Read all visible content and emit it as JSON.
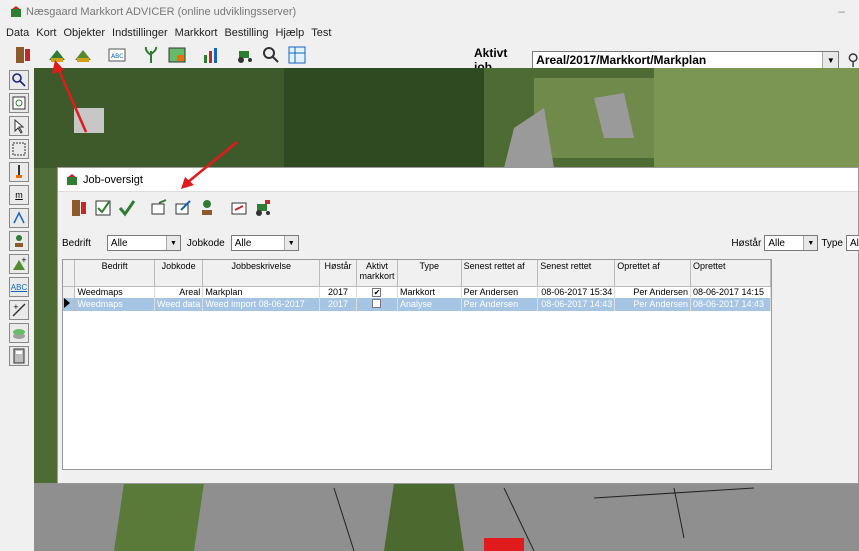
{
  "window": {
    "title": "Næsgaard Markkort ADVICER (online udviklingsserver)",
    "minimize": "–"
  },
  "menu": [
    "Data",
    "Kort",
    "Objekter",
    "Indstillinger",
    "Markkort",
    "Bestilling",
    "Hjælp",
    "Test"
  ],
  "job": {
    "label": "Aktivt job",
    "value": "Areal/2017/Markkort/Markplan"
  },
  "left_toolbar": {
    "abc": "ABC",
    "m_tool": "m"
  },
  "dialog": {
    "title": "Job-oversigt",
    "filters": {
      "bedrift_label": "Bedrift",
      "bedrift_value": "Alle",
      "jobkode_label": "Jobkode",
      "jobkode_value": "Alle",
      "hostar_label": "Høstår",
      "hostar_value": "Alle",
      "type_label": "Type",
      "type_value": "Alle"
    },
    "columns": [
      "Bedrift",
      "Jobkode",
      "Jobbeskrivelse",
      "Høstår",
      "Aktivt markkort",
      "Type",
      "Senest rettet af",
      "Senest rettet",
      "Oprettet af",
      "Oprettet"
    ],
    "rows": [
      {
        "bedrift": "Weedmaps",
        "jobkode": "Areal",
        "beskrivelse": "Markplan",
        "hostar": "2017",
        "aktivt": "✔",
        "type": "Markkort",
        "rettet_af": "Per Andersen",
        "rettet": "08-06-2017 15:34",
        "oprettet_af": "Per Andersen",
        "oprettet": "08-06-2017 14:15"
      },
      {
        "bedrift": "Weedmaps",
        "jobkode": "Weed data",
        "beskrivelse": "Weed import 08-06-2017",
        "hostar": "2017",
        "aktivt": "",
        "type": "Analyse",
        "rettet_af": "Per Andersen",
        "rettet": "08-06-2017 14:43",
        "oprettet_af": "Per Andersen",
        "oprettet": "08-06-2017 14:43"
      }
    ]
  },
  "colors": {
    "selected_row": "#a6c4e4",
    "arrow": "#e11b1b",
    "map_green": "#4d6b32"
  }
}
